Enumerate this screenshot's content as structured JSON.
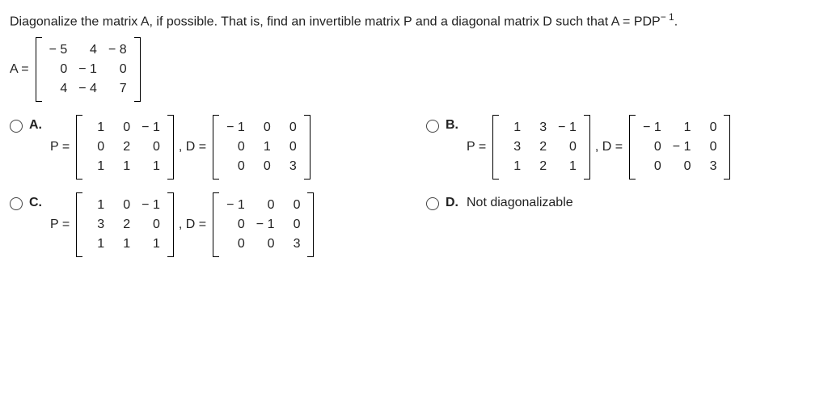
{
  "question": {
    "prefix": "Diagonalize the matrix A, if possible. That is, find an invertible matrix P and a diagonal matrix D such that ",
    "formula_lhs": "A = PDP",
    "formula_exp": "− 1",
    "suffix": "."
  },
  "A": {
    "label": "A =",
    "rows": [
      [
        "− 5",
        "4",
        "− 8"
      ],
      [
        "0",
        "− 1",
        "0"
      ],
      [
        "4",
        "− 4",
        "7"
      ]
    ]
  },
  "choices": {
    "a": {
      "letter": "A.",
      "P_label": "P =",
      "P": [
        [
          "1",
          "0",
          "− 1"
        ],
        [
          "0",
          "2",
          "0"
        ],
        [
          "1",
          "1",
          "1"
        ]
      ],
      "comma": ", D =",
      "D": [
        [
          "− 1",
          "0",
          "0"
        ],
        [
          "0",
          "1",
          "0"
        ],
        [
          "0",
          "0",
          "3"
        ]
      ]
    },
    "b": {
      "letter": "B.",
      "P_label": "P =",
      "P": [
        [
          "1",
          "3",
          "− 1"
        ],
        [
          "3",
          "2",
          "0"
        ],
        [
          "1",
          "2",
          "1"
        ]
      ],
      "comma": ", D =",
      "D": [
        [
          "− 1",
          "1",
          "0"
        ],
        [
          "0",
          "− 1",
          "0"
        ],
        [
          "0",
          "0",
          "3"
        ]
      ]
    },
    "c": {
      "letter": "C.",
      "P_label": "P =",
      "P": [
        [
          "1",
          "0",
          "− 1"
        ],
        [
          "3",
          "2",
          "0"
        ],
        [
          "1",
          "1",
          "1"
        ]
      ],
      "comma": ", D =",
      "D": [
        [
          "− 1",
          "0",
          "0"
        ],
        [
          "0",
          "− 1",
          "0"
        ],
        [
          "0",
          "0",
          "3"
        ]
      ]
    },
    "d": {
      "letter": "D.",
      "text": "Not diagonalizable"
    }
  }
}
